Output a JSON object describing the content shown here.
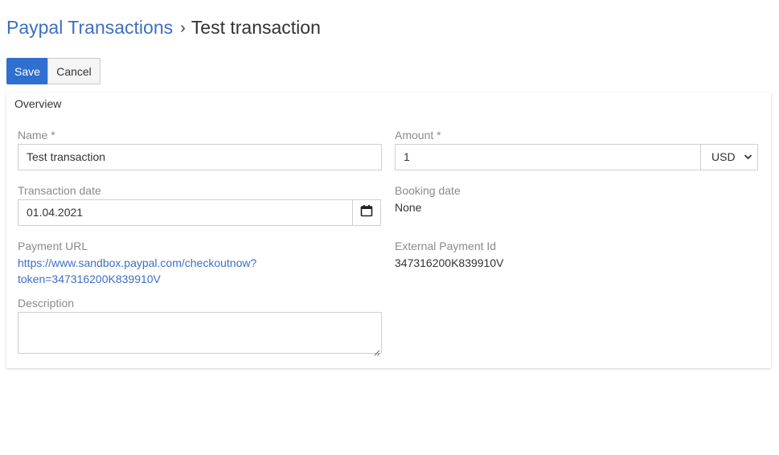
{
  "breadcrumb": {
    "parent": "Paypal Transactions",
    "separator": "›",
    "current": "Test transaction"
  },
  "toolbar": {
    "save_label": "Save",
    "cancel_label": "Cancel"
  },
  "panel": {
    "title": "Overview",
    "fields": {
      "name": {
        "label": "Name *",
        "value": "Test transaction"
      },
      "amount": {
        "label": "Amount *",
        "value": "1",
        "currency": "USD"
      },
      "transaction_date": {
        "label": "Transaction date",
        "value": "01.04.2021"
      },
      "booking_date": {
        "label": "Booking date",
        "value": "None"
      },
      "payment_url": {
        "label": "Payment URL",
        "line1": "https://www.sandbox.paypal.com/checkoutnow?",
        "line2": "token=347316200K839910V"
      },
      "external_payment_id": {
        "label": "External Payment Id",
        "value": "347316200K839910V"
      },
      "description": {
        "label": "Description",
        "value": ""
      }
    }
  },
  "colors": {
    "accent": "#2f6fcf",
    "link": "#3d6fc4",
    "label": "#8a8a8a",
    "border": "#cfcfcf"
  },
  "icons": {
    "calendar": "calendar-icon",
    "chevron": "chevron-down-icon",
    "resize": "resize-grip-icon"
  }
}
